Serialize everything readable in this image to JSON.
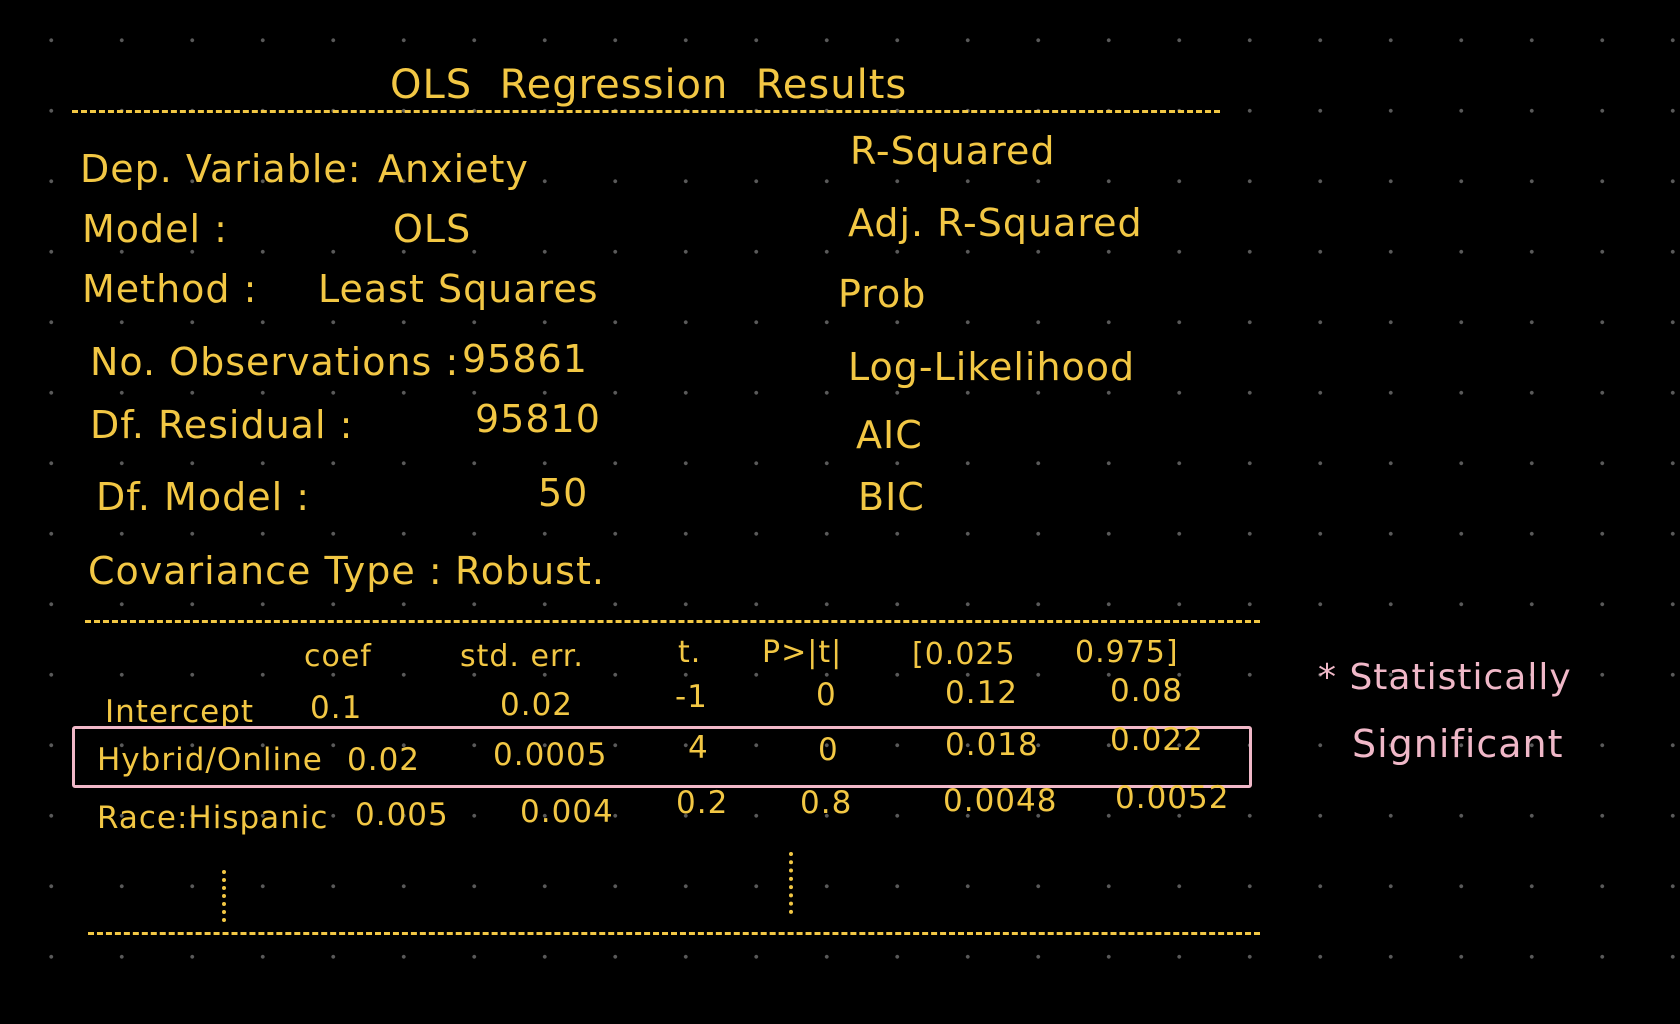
{
  "title": "OLS  Regression  Results",
  "info_left": [
    {
      "label": "Dep. Variable:",
      "value": "Anxiety"
    },
    {
      "label": "Model :",
      "value": "OLS"
    },
    {
      "label": "Method :",
      "value": "Least Squares"
    },
    {
      "label": "No. Observations :",
      "value": "95861"
    },
    {
      "label": "Df. Residual :",
      "value": "95810"
    },
    {
      "label": "Df. Model :",
      "value": "50"
    },
    {
      "label": "Covariance Type :",
      "value": "Robust."
    }
  ],
  "info_right": [
    "R-Squared",
    "Adj. R-Squared",
    "Prob",
    "Log-Likelihood",
    "AIC",
    "BIC"
  ],
  "table": {
    "headers": [
      "coef",
      "std. err.",
      "t.",
      "P>|t|",
      "[0.025",
      "0.975]"
    ],
    "rows": [
      {
        "name": "Intercept",
        "cells": [
          "0.1",
          "0.02",
          "-1",
          "0",
          "0.12",
          "0.08"
        ]
      },
      {
        "name": "Hybrid/Online",
        "cells": [
          "0.02",
          "0.0005",
          "4",
          "0",
          "0.018",
          "0.022"
        ]
      },
      {
        "name": "Race:Hispanic",
        "cells": [
          "0.005",
          "0.004",
          "0.2",
          "0.8",
          "0.0048",
          "0.0052"
        ]
      }
    ]
  },
  "annotation": {
    "line1": "* Statistically",
    "line2": "Significant"
  },
  "colors": {
    "ink": "#f2c744",
    "highlight": "#f0b8c8",
    "background": "#000000",
    "grid_dot": "#5a5a5a"
  }
}
